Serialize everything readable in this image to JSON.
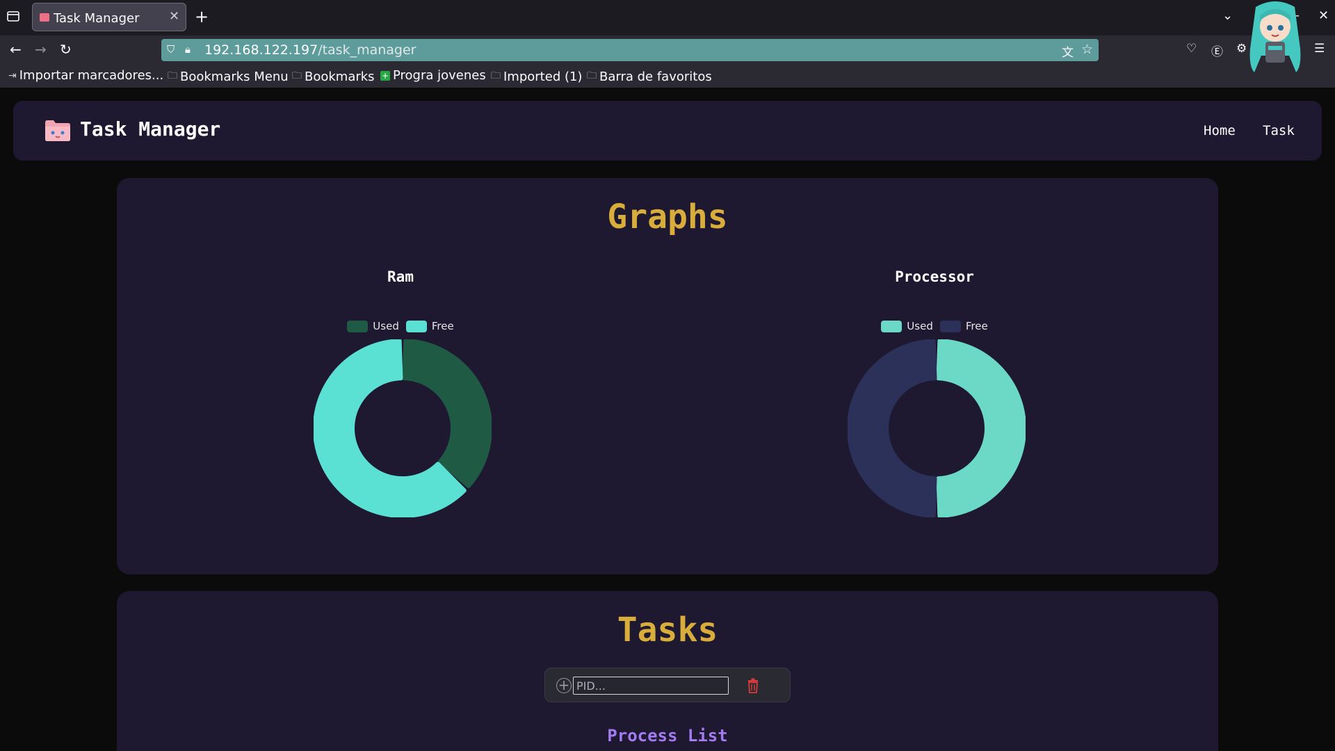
{
  "browser": {
    "tab": {
      "title": "Task Manager"
    },
    "url": {
      "host": "192.168.122.197",
      "path": "/task_manager"
    },
    "bookmarks": [
      {
        "label": "Importar marcadores...",
        "icon": "import-icon"
      },
      {
        "label": "Bookmarks Menu",
        "icon": "folder-icon"
      },
      {
        "label": "Bookmarks",
        "icon": "folder-icon"
      },
      {
        "label": "Progra jovenes",
        "icon": "green-plus-icon"
      },
      {
        "label": "Imported (1)",
        "icon": "folder-icon"
      },
      {
        "label": "Barra de favoritos",
        "icon": "folder-icon"
      }
    ]
  },
  "app": {
    "brand": "Task Manager",
    "nav": {
      "home": "Home",
      "task": "Task"
    }
  },
  "graphs": {
    "title": "Graphs",
    "ram": {
      "title": "Ram",
      "legend": {
        "used": "Used",
        "free": "Free"
      },
      "colors": {
        "used": "#1e5a44",
        "free": "#5be0d4"
      }
    },
    "processor": {
      "title": "Processor",
      "legend": {
        "used": "Used",
        "free": "Free"
      },
      "colors": {
        "used": "#6bd9c6",
        "free": "#2b3158"
      }
    }
  },
  "tasks": {
    "title": "Tasks",
    "pid_placeholder": "PID...",
    "process_list_title": "Process List"
  },
  "chart_data": [
    {
      "type": "pie",
      "title": "Ram",
      "categories": [
        "Used",
        "Free"
      ],
      "values": [
        37,
        63
      ],
      "colors": [
        "#1e5a44",
        "#5be0d4"
      ]
    },
    {
      "type": "pie",
      "title": "Processor",
      "categories": [
        "Used",
        "Free"
      ],
      "values": [
        50,
        50
      ],
      "colors": [
        "#6bd9c6",
        "#2b3158"
      ]
    }
  ]
}
